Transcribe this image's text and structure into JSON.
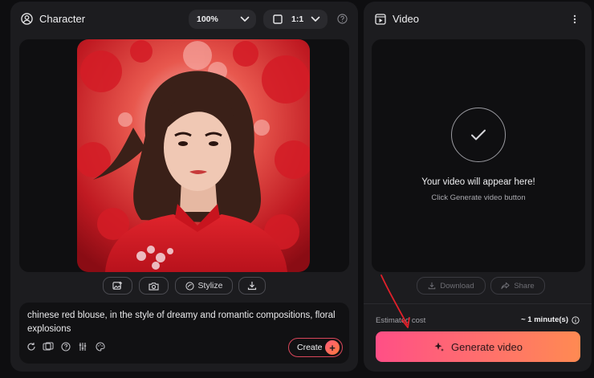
{
  "character_panel": {
    "title": "Character",
    "zoom_value": "100%",
    "ratio_value": "1:1",
    "tools": {
      "stylize_label": "Stylize"
    },
    "prompt": "chinese red blouse, in the style of dreamy and romantic compositions, floral explosions",
    "create_label": "Create"
  },
  "video_panel": {
    "title": "Video",
    "placeholder_title": "Your video will appear here!",
    "placeholder_hint": "Click Generate video button",
    "download_label": "Download",
    "share_label": "Share",
    "estimated_cost_label": "Estimated cost",
    "estimated_cost_value": "~ 1 minute(s)",
    "generate_label": "Generate video"
  },
  "colors": {
    "accent_red": "#d9465a",
    "gradient_start": "#ff4f86",
    "gradient_end": "#ff8a52",
    "annotation_arrow": "#e0202a"
  }
}
